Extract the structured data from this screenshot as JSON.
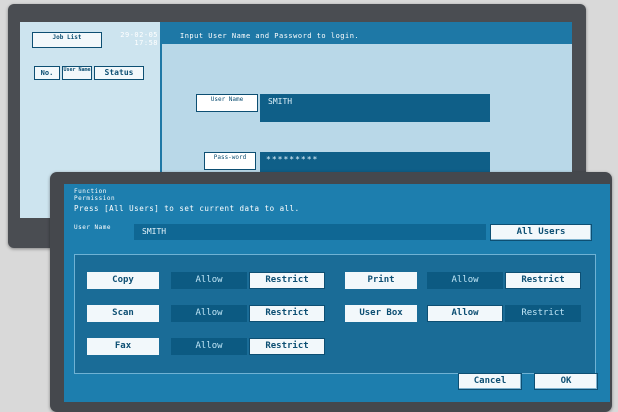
{
  "back": {
    "job_list_label": "Job List",
    "datetime_line1": "29-02-05",
    "datetime_line2": "17:58",
    "instruction": "Input User Name and Password to login.",
    "col_no": "No.",
    "col_user_name": "User Name",
    "col_status": "Status",
    "user_name_label": "User Name",
    "user_name_value": "SMITH",
    "password_label": "Pass-word",
    "password_value": "*********"
  },
  "dialog": {
    "title_line1": "Function",
    "title_line2": "Permission",
    "instruction": "Press [All Users] to set current data to all.",
    "user_name_label": "User Name",
    "user_name_value": "SMITH",
    "all_users_button": "All Users",
    "permissions": [
      {
        "label": "Copy",
        "allow": "Allow",
        "restrict": "Restrict",
        "selected": "Allow"
      },
      {
        "label": "Print",
        "allow": "Allow",
        "restrict": "Restrict",
        "selected": "Allow"
      },
      {
        "label": "Scan",
        "allow": "Allow",
        "restrict": "Restrict",
        "selected": "Allow"
      },
      {
        "label": "User Box",
        "allow": "Allow",
        "restrict": "Restrict",
        "selected": "Restrict"
      },
      {
        "label": "Fax",
        "allow": "Allow",
        "restrict": "Restrict",
        "selected": "Allow"
      }
    ],
    "cancel_button": "Cancel",
    "ok_button": "OK"
  },
  "colors": {
    "screen_blue": "#1d7eae",
    "selected_dark": "#0c5a82",
    "button_white": "#f2f8fb"
  }
}
